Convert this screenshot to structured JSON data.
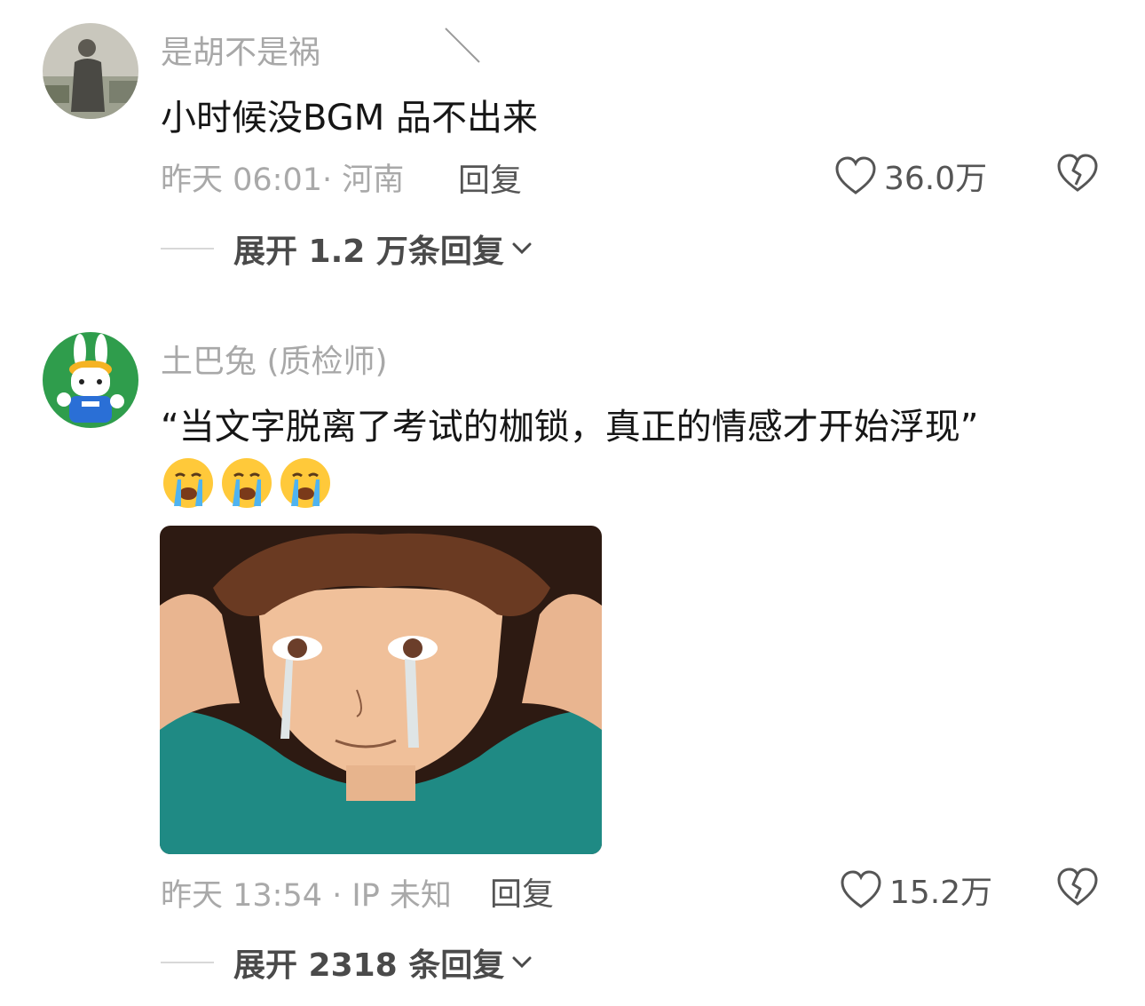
{
  "comments": [
    {
      "username": "是胡不是祸",
      "text": "小时候没BGM 品不出来",
      "time_location": "昨天 06:01· 河南",
      "reply_label": "回复",
      "likes": "36.0万",
      "expand_label": "展开 1.2 万条回复"
    },
    {
      "username": "土巴兔 (质检师)",
      "text": "“当文字脱离了考试的枷锁，真正的情感才开始浮现”",
      "emojis": [
        "crying-face",
        "crying-face",
        "crying-face"
      ],
      "time_location": "昨天 13:54 · IP 未知",
      "reply_label": "回复",
      "likes": "15.2万",
      "expand_label": "展开 2318 条回复"
    }
  ],
  "colors": {
    "username": "#a8a8a8",
    "meta": "#a9a9a9",
    "text": "#161616",
    "teal_shirt": "#1f8a84"
  }
}
